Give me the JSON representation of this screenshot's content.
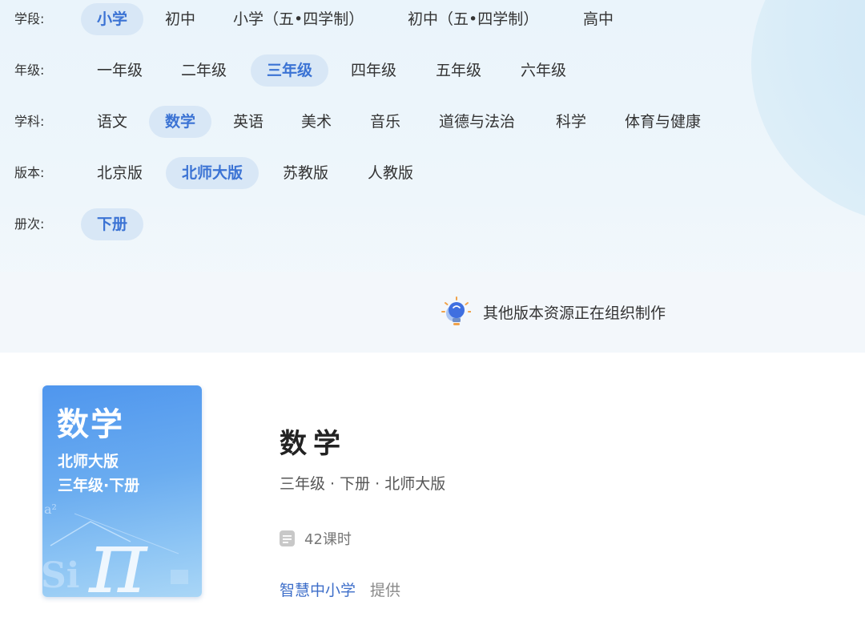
{
  "filters": {
    "stage": {
      "label": "学段:",
      "options": [
        "小学",
        "初中",
        "小学（五•四学制）",
        "初中（五•四学制）",
        "高中"
      ],
      "selected": 0
    },
    "grade": {
      "label": "年级:",
      "options": [
        "一年级",
        "二年级",
        "三年级",
        "四年级",
        "五年级",
        "六年级"
      ],
      "selected": 2
    },
    "subject": {
      "label": "学科:",
      "options": [
        "语文",
        "数学",
        "英语",
        "美术",
        "音乐",
        "道德与法治",
        "科学",
        "体育与健康"
      ],
      "selected": 1
    },
    "edition": {
      "label": "版本:",
      "options": [
        "北京版",
        "北师大版",
        "苏教版",
        "人教版"
      ],
      "selected": 1
    },
    "volume": {
      "label": "册次:",
      "options": [
        "下册"
      ],
      "selected": 0
    }
  },
  "notice": {
    "icon": "lightbulb-icon",
    "text": "其他版本资源正在组织制作"
  },
  "course": {
    "cover": {
      "title": "数学",
      "edition": "北师大版",
      "grade_volume": "三年级·下册"
    },
    "title": "数学",
    "meta": "三年级 · 下册 · 北师大版",
    "lessons": "42课时",
    "provider": "智慧中小学",
    "provider_suffix": "提供"
  },
  "colors": {
    "accent": "#3b73d4",
    "chip_selected_bg": "#d8e7f6",
    "provider": "#3d6ec9"
  }
}
